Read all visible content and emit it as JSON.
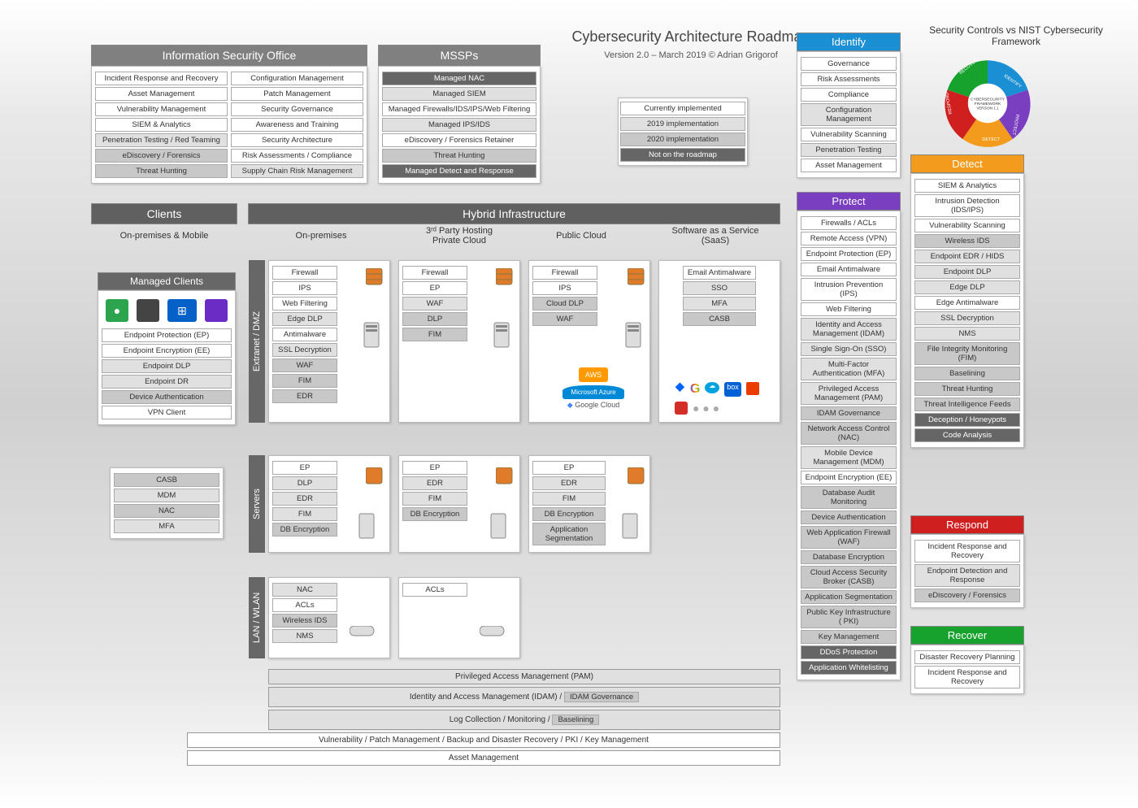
{
  "title": "Cybersecurity Architecture Roadmap",
  "version": "Version 2.0 – March 2019 ©  Adrian Grigorof",
  "legend": {
    "a": "Currently implemented",
    "b": "2019 implementation",
    "c": "2020 implementation",
    "d": "Not on the roadmap"
  },
  "iso": {
    "title": "Information Security Office",
    "left": [
      "Incident Response and Recovery",
      "Asset Management",
      "Vulnerability Management",
      "SIEM & Analytics",
      "Penetration Testing / Red Teaming",
      "eDiscovery / Forensics",
      "Threat Hunting"
    ],
    "right": [
      "Configuration Management",
      "Patch Management",
      "Security Governance",
      "Awareness and Training",
      "Security Architecture",
      "Risk Assessments / Compliance",
      "Supply Chain Risk Management"
    ]
  },
  "mssp": {
    "title": "MSSPs",
    "items": [
      "Managed NAC",
      "Managed SIEM",
      "Managed Firewalls/IDS/IPS/Web Filtering",
      "Managed IPS/IDS",
      "eDiscovery / Forensics Retainer",
      "Threat Hunting",
      "Managed Detect and Response"
    ]
  },
  "clients": {
    "title": "Clients",
    "sub": "On-premises & Mobile",
    "mgd": "Managed Clients",
    "items": [
      "Endpoint Protection (EP)",
      "Endpoint Encryption (EE)",
      "Endpoint DLP",
      "Endpoint DR",
      "Device Authentication",
      "VPN Client"
    ],
    "extra": [
      "CASB",
      "MDM",
      "NAC",
      "MFA"
    ]
  },
  "hybrid": {
    "title": "Hybrid Infrastructure",
    "cols": {
      "onprem": "On-premises",
      "third": "3ʳᵈ Party Hosting\nPrivate Cloud",
      "public": "Public Cloud",
      "saas": "Software as a Service\n(SaaS)"
    }
  },
  "tiers": {
    "dmz": "Extranet / DMZ",
    "srv": "Servers",
    "lan": "LAN / WLAN"
  },
  "dmz": {
    "onprem": [
      "Firewall",
      "IPS",
      "Web Filtering",
      "Edge DLP",
      "Antimalware",
      "SSL Decryption",
      "WAF",
      "FIM",
      "EDR"
    ],
    "third": [
      "Firewall",
      "EP",
      "WAF",
      "DLP",
      "FIM"
    ],
    "public": [
      "Firewall",
      "IPS",
      "Cloud DLP",
      "WAF"
    ],
    "saas": [
      "Email Antimalware",
      "SSO",
      "MFA",
      "CASB"
    ]
  },
  "srv": {
    "onprem": [
      "EP",
      "DLP",
      "EDR",
      "FIM",
      "DB Encryption"
    ],
    "third": [
      "EP",
      "EDR",
      "FIM",
      "DB Encryption"
    ],
    "public": [
      "EP",
      "EDR",
      "FIM",
      "DB Encryption",
      "Application Segmentation"
    ]
  },
  "lan": {
    "onprem": [
      "NAC",
      "ACLs",
      "Wireless IDS",
      "NMS"
    ],
    "third": [
      "ACLs"
    ]
  },
  "bars": [
    "Privileged Access Management (PAM)",
    "Identity and Access Management (IDAM) /",
    "Log Collection / Monitoring /",
    "Vulnerability / Patch Management / Backup and Disaster Recovery / PKI / Key Management",
    "Asset Management"
  ],
  "barext": {
    "idam": "IDAM Governance",
    "base": "Baselining"
  },
  "nist": {
    "title": "Security Controls vs NIST Cybersecurity Framework",
    "identify": {
      "t": "Identify",
      "c": "#1b8fd4",
      "items": [
        "Governance",
        "Risk Assessments",
        "Compliance",
        "Configuration Management",
        "Vulnerability Scanning",
        "Penetration Testing",
        "Asset Management"
      ]
    },
    "protect": {
      "t": "Protect",
      "c": "#7a3fc0",
      "items": [
        "Firewalls / ACLs",
        "Remote Access (VPN)",
        "Endpoint Protection (EP)",
        "Email Antimalware",
        "Intrusion Prevention (IPS)",
        "Web Filtering",
        "Identity and Access Management (IDAM)",
        "Single Sign-On (SSO)",
        "Multi-Factor Authentication (MFA)",
        "Privileged Access Management (PAM)",
        "IDAM Governance",
        "Network Access Control (NAC)",
        "Mobile Device Management (MDM)",
        "Endpoint Encryption (EE)",
        "Database Audit Monitoring",
        "Device Authentication",
        "Web Application Firewall (WAF)",
        "Database Encryption",
        "Cloud Access Security Broker (CASB)",
        "Application Segmentation",
        "Public Key Infrastructure ( PKI)",
        "Key Management",
        "DDoS Protection",
        "Application Whitelisting"
      ]
    },
    "detect": {
      "t": "Detect",
      "c": "#f29b1d",
      "items": [
        "SIEM & Analytics",
        "Intrusion Detection (IDS/IPS)",
        "Vulnerability Scanning",
        "Wireless IDS",
        "Endpoint EDR / HIDS",
        "Endpoint DLP",
        "Edge DLP",
        "Edge Antimalware",
        "SSL Decryption",
        "NMS",
        "File Integrity Monitoring (FIM)",
        "Baselining",
        "Threat Hunting",
        "Threat Intelligence Feeds",
        "Deception / Honeypots",
        "Code Analysis"
      ]
    },
    "respond": {
      "t": "Respond",
      "c": "#d01f1f",
      "items": [
        "Incident Response and Recovery",
        "Endpoint Detection and Response",
        "eDiscovery / Forensics"
      ]
    },
    "recover": {
      "t": "Recover",
      "c": "#17a22d",
      "items": [
        "Disaster Recovery Planning",
        "Incident Response and Recovery"
      ]
    }
  },
  "clouds": {
    "aws": "AWS",
    "azure": "Microsoft Azure",
    "gcp": "Google Cloud"
  }
}
